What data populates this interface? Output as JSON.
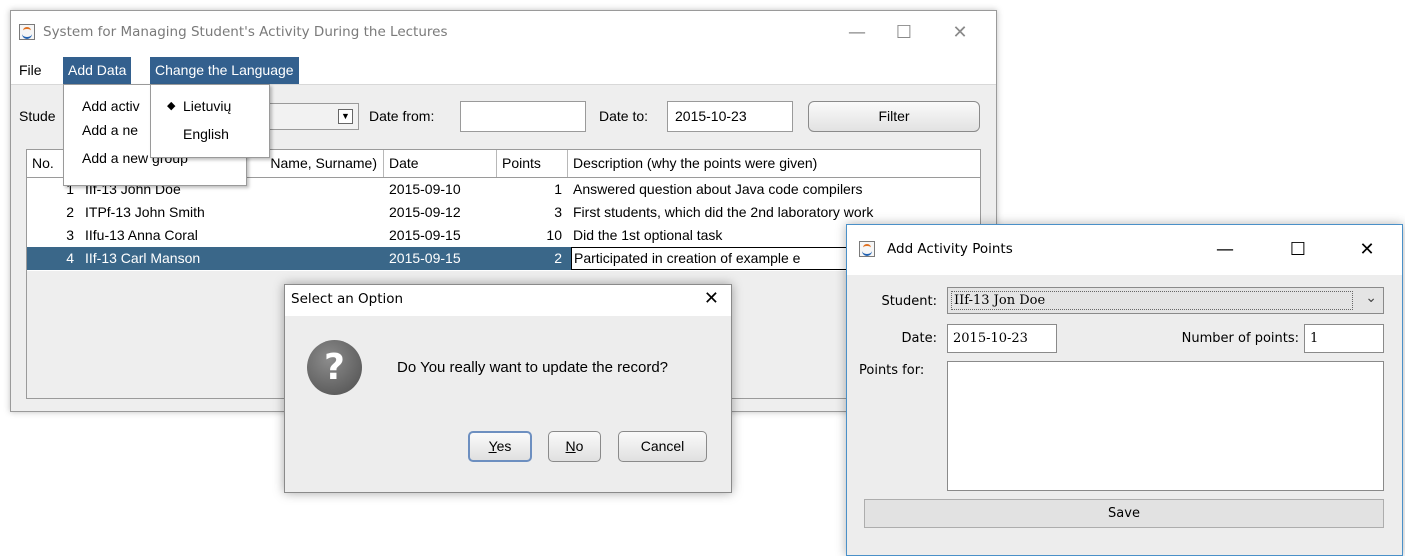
{
  "main_window": {
    "title": "System for Managing Student's Activity During the Lectures",
    "controls": {
      "minimize": "—",
      "maximize": "☐",
      "close": "✕"
    },
    "menubar": {
      "file": "File",
      "add_data": "Add Data",
      "change_language": "Change the Language"
    },
    "add_data_menu": [
      "Add activ",
      "Add a ne",
      "Add a new group"
    ],
    "language_menu": {
      "selected_marker": "◆",
      "items": [
        "Lietuvių",
        "English"
      ]
    },
    "filter": {
      "student_label": "Stude",
      "date_from_label": "Date from:",
      "date_from_value": "",
      "date_to_label": "Date to:",
      "date_to_value": "2015-10-23",
      "filter_button": "Filter"
    },
    "table": {
      "columns": [
        "No.",
        "Student (Group, Name, Surname)",
        "Date",
        "Points",
        "Description (why the points were given)"
      ],
      "student_header_visible": "Name, Surname)",
      "rows": [
        {
          "no": "1",
          "student": "IIf-13 John Doe",
          "date": "2015-09-10",
          "points": "1",
          "description": "Answered question about Java code compilers"
        },
        {
          "no": "2",
          "student": "ITPf-13 John Smith",
          "date": "2015-09-12",
          "points": "3",
          "description": "First students, which did the 2nd laboratory work"
        },
        {
          "no": "3",
          "student": "IIfu-13 Anna Coral",
          "date": "2015-09-15",
          "points": "10",
          "description": "Did the 1st optional task"
        },
        {
          "no": "4",
          "student": "IIf-13 Carl Manson",
          "date": "2015-09-15",
          "points": "2",
          "description": "Participated in creation of example e"
        }
      ],
      "selected_row": 3
    }
  },
  "confirm_dialog": {
    "title": "Select an Option",
    "close": "✕",
    "icon": "?",
    "message": "Do You really want to update the record?",
    "buttons": {
      "yes_mnemonic": "Y",
      "yes_rest": "es",
      "no_mnemonic": "N",
      "no_rest": "o",
      "cancel": "Cancel"
    }
  },
  "activity_window": {
    "title": "Add Activity Points",
    "controls": {
      "minimize": "—",
      "maximize": "☐",
      "close": "✕"
    },
    "student_label": "Student:",
    "student_value": "IIf-13 Jon Doe",
    "date_label": "Date:",
    "date_value": "2015-10-23",
    "points_label": "Number of points:",
    "points_value": "1",
    "points_for_label": "Points for:",
    "points_for_value": "",
    "save_button": "Save"
  },
  "colors": {
    "menu_active": "#33608e",
    "row_selected": "#3a6789",
    "default_button_border": "#6d8fc0"
  }
}
